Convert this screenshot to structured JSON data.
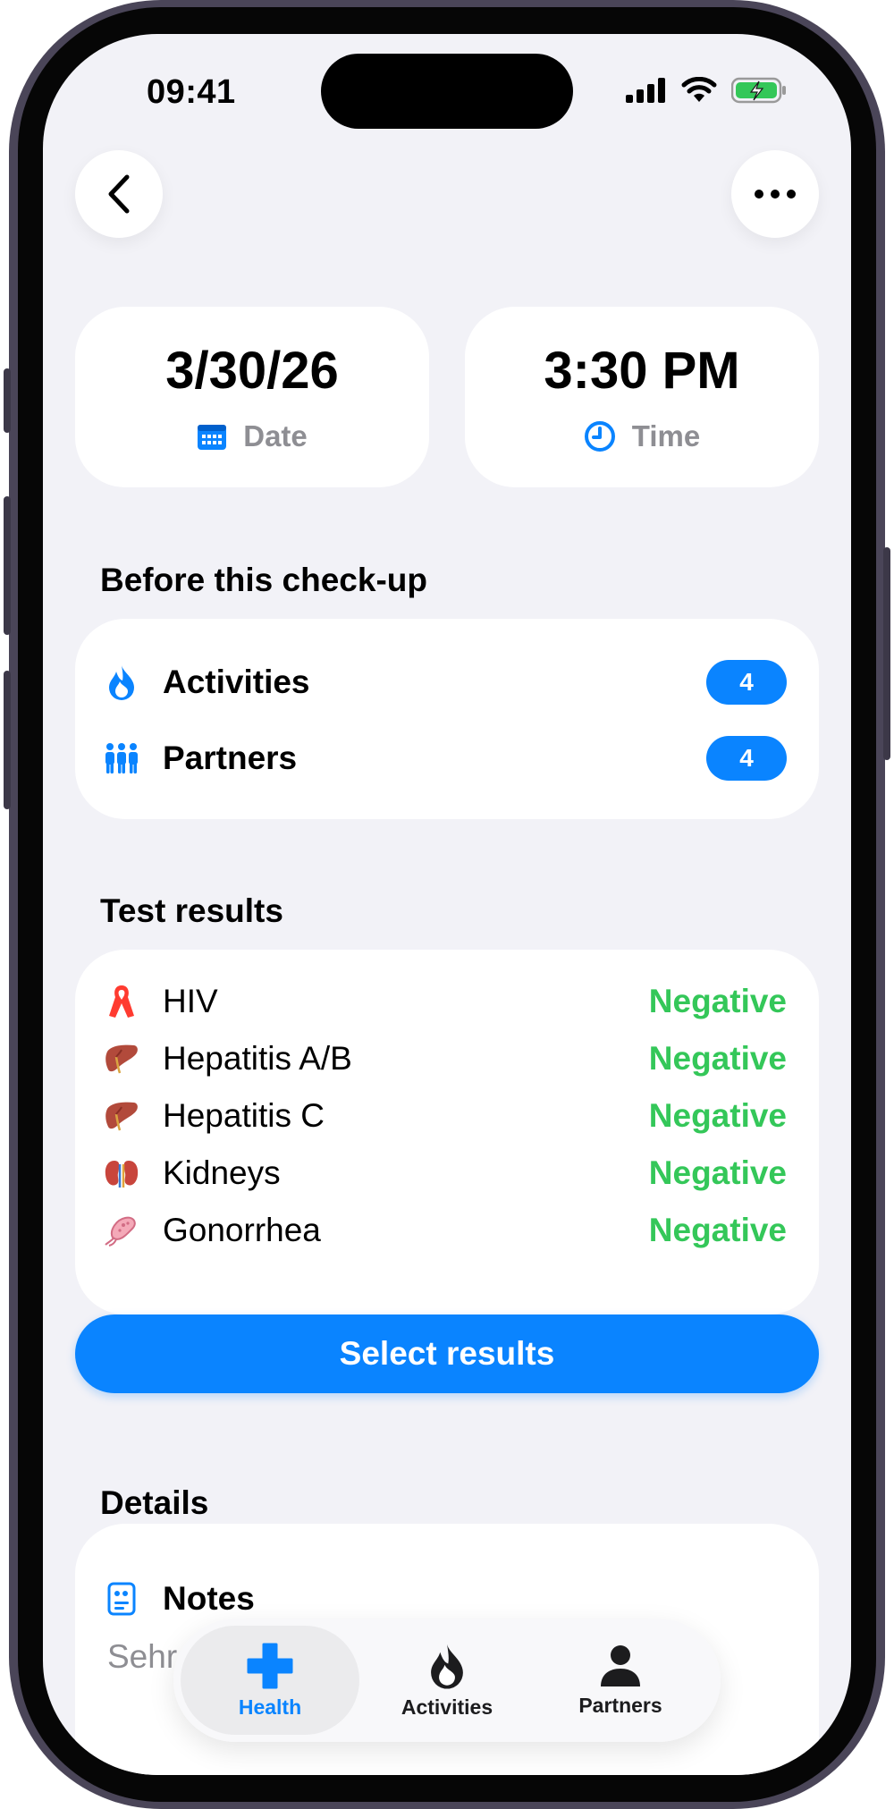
{
  "status_bar": {
    "time": "09:41"
  },
  "checkup": {
    "date_value": "3/30/26",
    "date_label": "Date",
    "time_value": "3:30 PM",
    "time_label": "Time"
  },
  "before_section": {
    "title": "Before this check-up",
    "items": [
      {
        "label": "Activities",
        "count": "4",
        "icon": "flame-icon"
      },
      {
        "label": "Partners",
        "count": "4",
        "icon": "people-icon"
      }
    ]
  },
  "results_section": {
    "title": "Test results",
    "items": [
      {
        "label": "HIV",
        "result": "Negative",
        "icon": "ribbon-icon"
      },
      {
        "label": "Hepatitis A/B",
        "result": "Negative",
        "icon": "liver-icon"
      },
      {
        "label": "Hepatitis C",
        "result": "Negative",
        "icon": "liver-icon"
      },
      {
        "label": "Kidneys",
        "result": "Negative",
        "icon": "kidneys-icon"
      },
      {
        "label": "Gonorrhea",
        "result": "Negative",
        "icon": "bacteria-icon"
      }
    ],
    "select_button": "Select results"
  },
  "details_section": {
    "title": "Details",
    "notes_label": "Notes",
    "notes_preview": "Sehr"
  },
  "tabbar": {
    "tabs": [
      {
        "label": "Health",
        "icon": "plus-icon",
        "active": true
      },
      {
        "label": "Activities",
        "icon": "flame-icon",
        "active": false
      },
      {
        "label": "Partners",
        "icon": "person-icon",
        "active": false
      }
    ]
  },
  "colors": {
    "accent": "#0a84ff",
    "success": "#34c759",
    "background": "#f2f2f7"
  }
}
